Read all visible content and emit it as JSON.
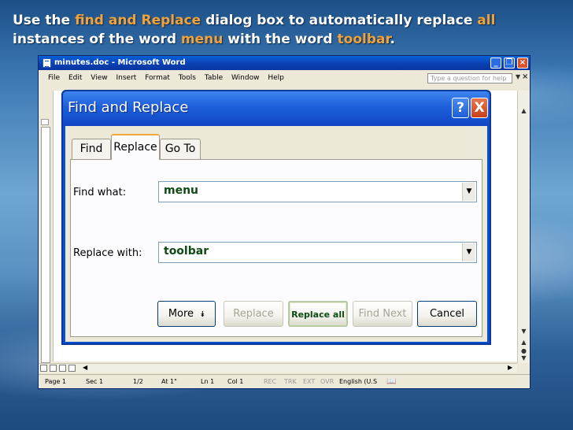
{
  "instruction": {
    "parts": [
      {
        "text": "Use the ",
        "highlight": false
      },
      {
        "text": "find and Replace",
        "highlight": true
      },
      {
        "text": " dialog box to automatically replace ",
        "highlight": false
      },
      {
        "text": "all",
        "highlight": true
      },
      {
        "text": " instances of the word ",
        "highlight": false
      },
      {
        "text": "menu",
        "highlight": true
      },
      {
        "text": " with the word ",
        "highlight": false
      },
      {
        "text": "toolbar",
        "highlight": true
      },
      {
        "text": ".",
        "highlight": false
      }
    ],
    "highlight_color": "#f2a23a"
  },
  "word_window": {
    "title": "minutes.doc - Microsoft Word",
    "menu": [
      "File",
      "Edit",
      "View",
      "Insert",
      "Format",
      "Tools",
      "Table",
      "Window",
      "Help"
    ],
    "ask_placeholder": "Type a question for help",
    "status": {
      "page": "Page 1",
      "sec": "Sec 1",
      "pages": "1/2",
      "at": "At 1\"",
      "ln": "Ln 1",
      "col": "Col 1",
      "rec": "REC",
      "trk": "TRK",
      "ext": "EXT",
      "ovr": "OVR",
      "language": "English (U.S"
    }
  },
  "dialog": {
    "title": "Find and Replace",
    "help_label": "?",
    "close_label": "X",
    "tabs": [
      "Find",
      "Replace",
      "Go To"
    ],
    "active_tab": "Replace",
    "find_label": "Find what:",
    "find_value": "menu",
    "replace_label": "Replace with:",
    "replace_value": "toolbar",
    "buttons": {
      "more": "More",
      "more_icon": "double-chevron-down-icon",
      "replace": "Replace",
      "replace_all": "Replace all",
      "find_next": "Find Next",
      "cancel": "Cancel"
    }
  }
}
